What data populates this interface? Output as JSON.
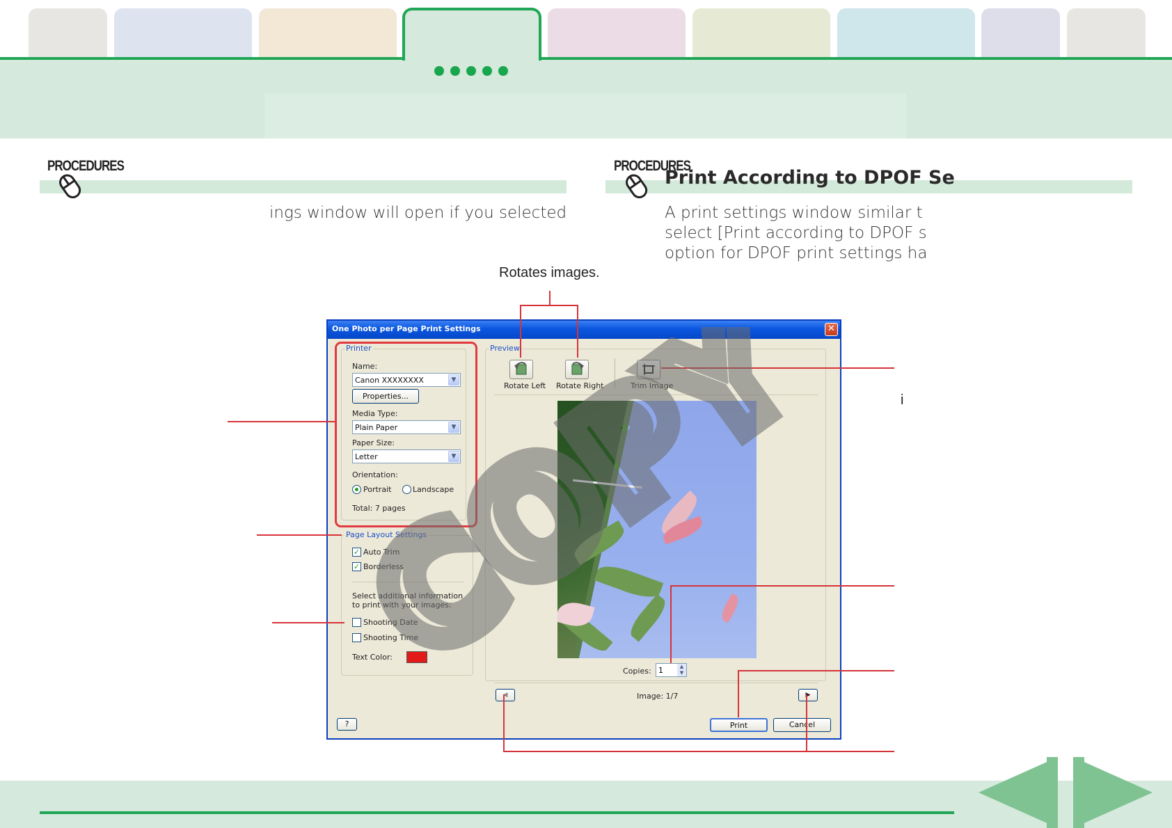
{
  "colors": {
    "accent_green": "#20a656",
    "band_green": "#d5e9dc",
    "callout_red": "#d63339",
    "tab_colors": [
      "#e8e6e2",
      "#dde4ef",
      "#f3e7d6",
      "#d5e9dc",
      "#ecdce6",
      "#e6ead4",
      "#cfe6eb",
      "#deddea",
      "#e8e6e2"
    ]
  },
  "left_section": {
    "procedures_label": "PROCEDURES",
    "body_text": "ings window will open if you selected"
  },
  "right_section": {
    "procedures_label": "PROCEDURES",
    "title": "Print According to DPOF Se",
    "body_lines": [
      "A print settings window similar t",
      "select [Print according to DPOF s",
      "option for DPOF print settings ha"
    ]
  },
  "callouts": {
    "rotate_label": "Rotates images.",
    "fragment": "i"
  },
  "dialog": {
    "title": "One Photo per Page Print Settings",
    "close_symbol": "✕",
    "printer_group": "Printer",
    "name_label": "Name:",
    "printer_name": "Canon XXXXXXXX",
    "properties_button": "Properties...",
    "media_type_label": "Media Type:",
    "media_type_value": "Plain Paper",
    "paper_size_label": "Paper Size:",
    "paper_size_value": "Letter",
    "orientation_label": "Orientation:",
    "portrait_label": "Portrait",
    "landscape_label": "Landscape",
    "total_pages": "Total: 7 pages",
    "layout_group": "Page Layout Settings",
    "auto_trim_label": "Auto Trim",
    "borderless_label": "Borderless",
    "additional_info_line1": "Select additional information",
    "additional_info_line2": "to print with your images:",
    "shooting_date_label": "Shooting Date",
    "shooting_time_label": "Shooting Time",
    "text_color_label": "Text Color:",
    "text_color_value": "#e31a1a",
    "preview_group": "Preview",
    "rotate_left_label": "Rotate Left",
    "rotate_right_label": "Rotate Right",
    "trim_image_label": "Trim Image",
    "copies_label": "Copies:",
    "copies_value": "1",
    "image_counter": "Image: 1/7",
    "help_button": "?",
    "print_button": "Print",
    "cancel_button": "Cancel"
  },
  "watermark": "COPY"
}
